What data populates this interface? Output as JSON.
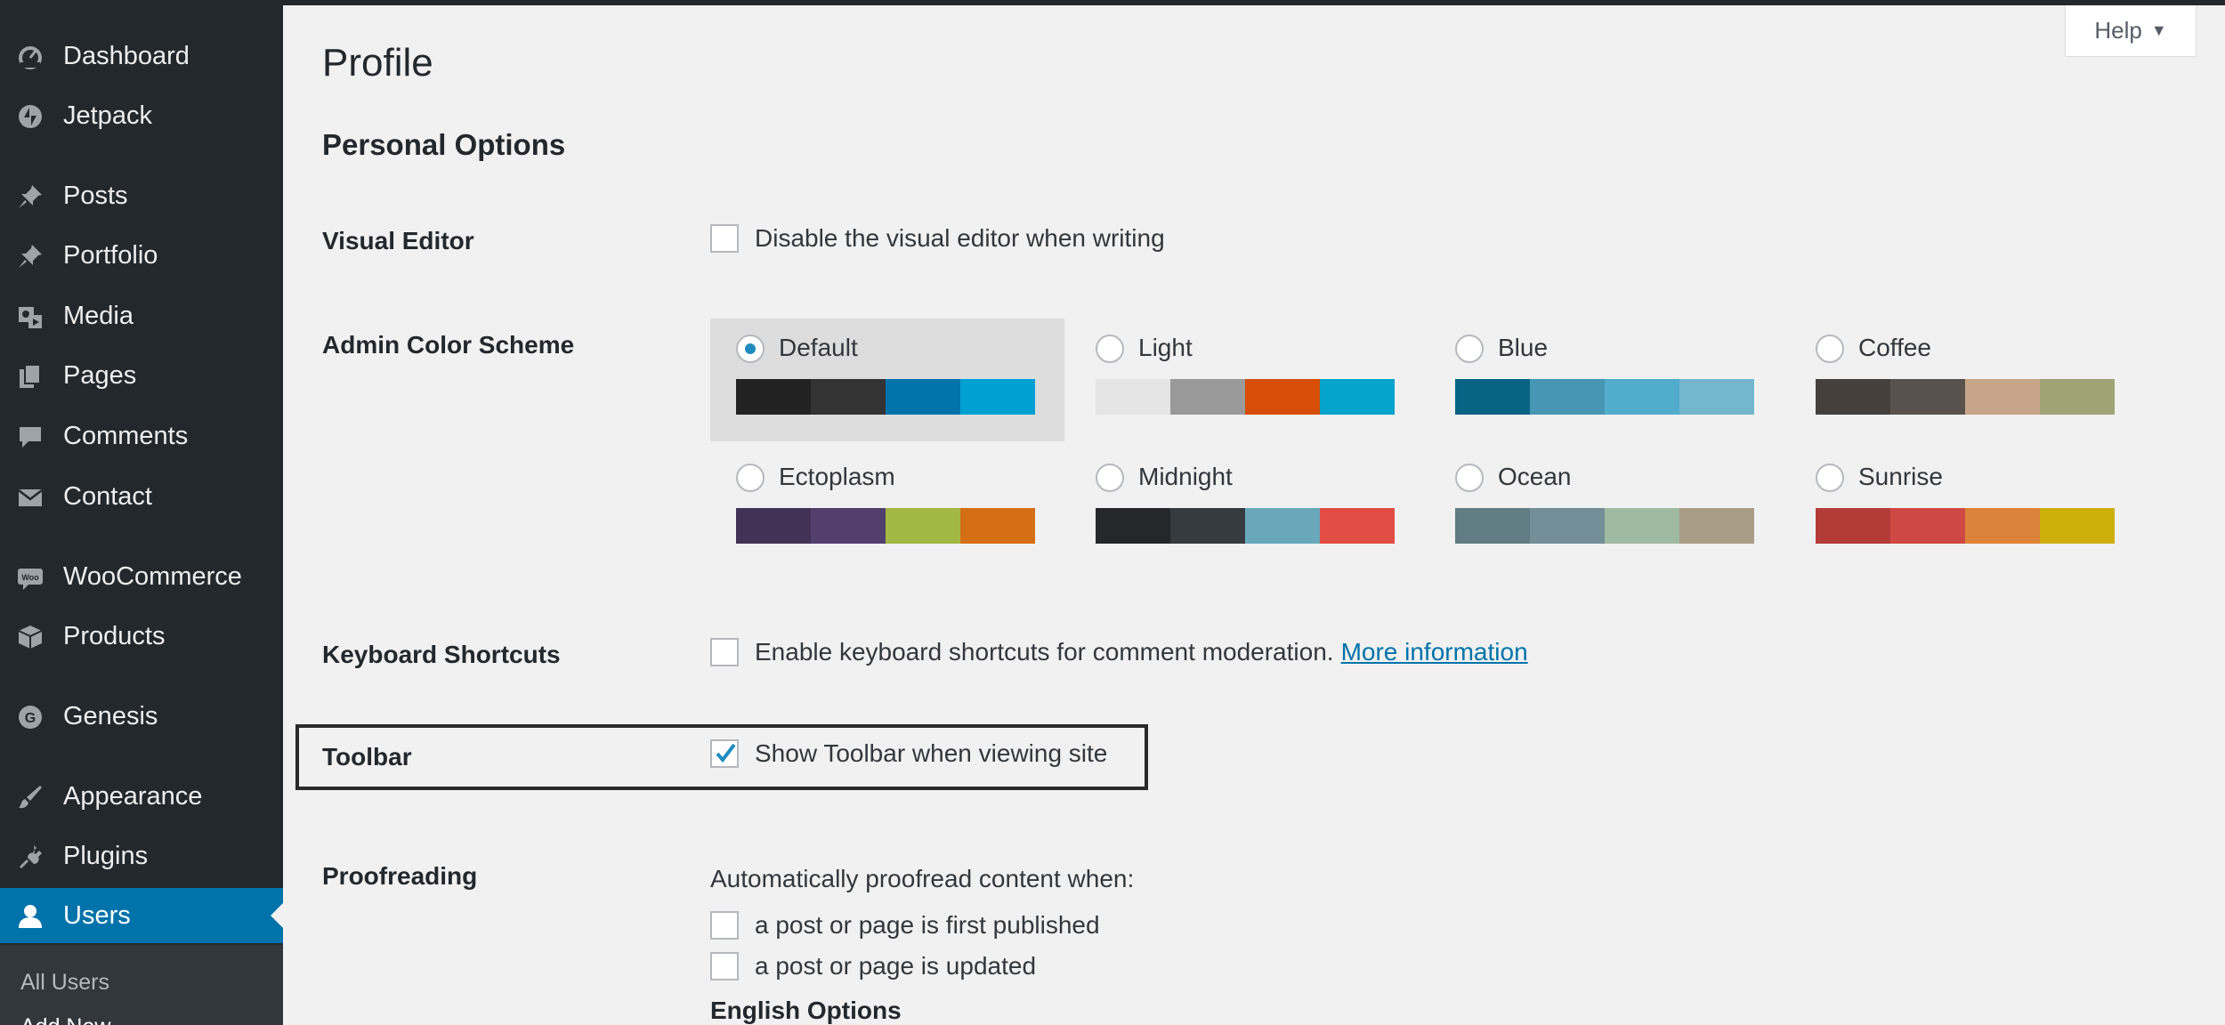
{
  "sidebar": {
    "items": [
      {
        "label": "Dashboard",
        "icon": "dashboard-icon"
      },
      {
        "label": "Jetpack",
        "icon": "jetpack-icon"
      },
      {
        "label": "Posts",
        "icon": "pin-icon"
      },
      {
        "label": "Portfolio",
        "icon": "pin-icon"
      },
      {
        "label": "Media",
        "icon": "media-icon"
      },
      {
        "label": "Pages",
        "icon": "pages-icon"
      },
      {
        "label": "Comments",
        "icon": "comment-icon"
      },
      {
        "label": "Contact",
        "icon": "mail-icon"
      },
      {
        "label": "WooCommerce",
        "icon": "woo-icon",
        "icon_text": "Woo"
      },
      {
        "label": "Products",
        "icon": "box-icon"
      },
      {
        "label": "Genesis",
        "icon": "genesis-icon",
        "icon_text": "G"
      },
      {
        "label": "Appearance",
        "icon": "brush-icon"
      },
      {
        "label": "Plugins",
        "icon": "plug-icon"
      },
      {
        "label": "Users",
        "icon": "user-icon",
        "active": true
      }
    ],
    "submenu": [
      {
        "label": "All Users"
      },
      {
        "label": "Add New"
      }
    ]
  },
  "header": {
    "title": "Profile",
    "help_label": "Help",
    "help_caret": "▼"
  },
  "personal_options": {
    "title": "Personal Options",
    "visual_editor": {
      "label": "Visual Editor",
      "option": "Disable the visual editor when writing",
      "checked": false
    },
    "color_scheme": {
      "label": "Admin Color Scheme",
      "selected": "Default",
      "schemes": [
        {
          "name": "Default",
          "colors": [
            "#222222",
            "#333333",
            "#0073aa",
            "#00a0d2"
          ]
        },
        {
          "name": "Light",
          "colors": [
            "#e5e5e5",
            "#999999",
            "#d64e07",
            "#04a4cc"
          ]
        },
        {
          "name": "Blue",
          "colors": [
            "#096484",
            "#4796b3",
            "#52accc",
            "#74b6ce"
          ]
        },
        {
          "name": "Coffee",
          "colors": [
            "#46403c",
            "#59524c",
            "#c7a589",
            "#9ea476"
          ]
        },
        {
          "name": "Ectoplasm",
          "colors": [
            "#413256",
            "#523f6d",
            "#a3b745",
            "#d46f15"
          ]
        },
        {
          "name": "Midnight",
          "colors": [
            "#25282b",
            "#363b3f",
            "#69a8bb",
            "#e14d43"
          ]
        },
        {
          "name": "Ocean",
          "colors": [
            "#627c83",
            "#738e96",
            "#9ebaa0",
            "#aa9d88"
          ]
        },
        {
          "name": "Sunrise",
          "colors": [
            "#b43c38",
            "#cf4944",
            "#dd823b",
            "#ccaf0b"
          ]
        }
      ]
    },
    "keyboard_shortcuts": {
      "label": "Keyboard Shortcuts",
      "option": "Enable keyboard shortcuts for comment moderation.",
      "link": "More information",
      "checked": false
    },
    "toolbar": {
      "label": "Toolbar",
      "option": "Show Toolbar when viewing site",
      "checked": true
    },
    "proofreading": {
      "label": "Proofreading",
      "intro": "Automatically proofread content when:",
      "options": [
        {
          "label": "a post or page is first published",
          "checked": false
        },
        {
          "label": "a post or page is updated",
          "checked": false
        }
      ],
      "english_options": "English Options"
    }
  }
}
